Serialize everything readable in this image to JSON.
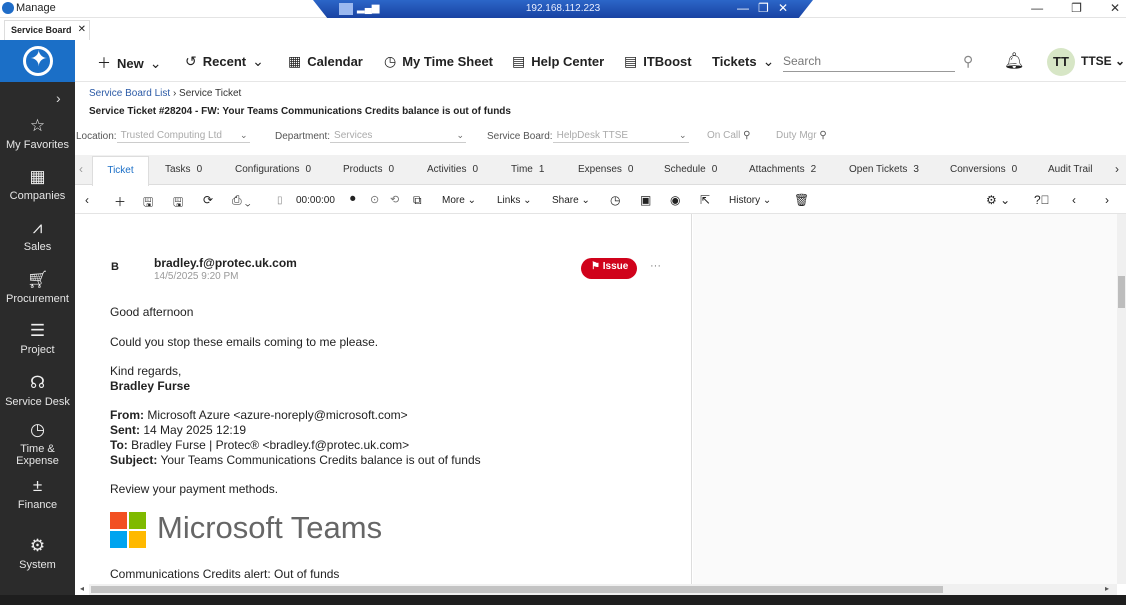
{
  "window": {
    "title": "Manage",
    "ip": "192.168.112.223"
  },
  "browser_tab": {
    "label": "Service Board"
  },
  "header": {
    "new": "New",
    "recent": "Recent",
    "calendar": "Calendar",
    "timesheet": "My Time Sheet",
    "help": "Help Center",
    "itboost": "ITBoost",
    "tickets": "Tickets",
    "search_placeholder": "Search",
    "avatar_initials": "TT",
    "user": "TTSE"
  },
  "sidebar": {
    "items": [
      {
        "label": "My Favorites",
        "icon": "star-icon"
      },
      {
        "label": "Companies",
        "icon": "building-icon"
      },
      {
        "label": "Sales",
        "icon": "chart-icon"
      },
      {
        "label": "Procurement",
        "icon": "cart-icon"
      },
      {
        "label": "Project",
        "icon": "project-icon"
      },
      {
        "label": "Service Desk",
        "icon": "headset-icon"
      },
      {
        "label": "Time &",
        "label2": "Expense",
        "icon": "clock-icon"
      },
      {
        "label": "Finance",
        "icon": "calculator-icon"
      },
      {
        "label": "System",
        "icon": "gear-icon"
      }
    ]
  },
  "breadcrumb": {
    "list": "Service Board List",
    "current": "Service Ticket"
  },
  "ticket": {
    "title": "Service Ticket #28204 - FW: Your Teams Communications Credits balance is out of funds"
  },
  "filters": {
    "location_label": "Location:",
    "location_value": "Trusted Computing Ltd",
    "department_label": "Department:",
    "department_value": "Services",
    "board_label": "Service Board:",
    "board_value": "HelpDesk TTSE",
    "on_call": "On Call",
    "duty_mgr": "Duty Mgr"
  },
  "tabs": [
    {
      "label": "Ticket",
      "count": ""
    },
    {
      "label": "Tasks",
      "count": "0"
    },
    {
      "label": "Configurations",
      "count": "0"
    },
    {
      "label": "Products",
      "count": "0"
    },
    {
      "label": "Activities",
      "count": "0"
    },
    {
      "label": "Time",
      "count": "1"
    },
    {
      "label": "Expenses",
      "count": "0"
    },
    {
      "label": "Schedule",
      "count": "0"
    },
    {
      "label": "Attachments",
      "count": "2"
    },
    {
      "label": "Open Tickets",
      "count": "3"
    },
    {
      "label": "Conversions",
      "count": "0"
    },
    {
      "label": "Audit Trail",
      "count": ""
    }
  ],
  "toolbar": {
    "timer": "00:00:00",
    "more": "More",
    "links": "Links",
    "share": "Share",
    "history": "History"
  },
  "email": {
    "avatar": "B",
    "sender": "bradley.f@protec.uk.com",
    "date": "14/5/2025 9:20 PM",
    "badge": "Issue",
    "greeting": "Good afternoon",
    "body": "Could you stop these emails coming to me please.",
    "regards": "Kind regards,",
    "signature": "Bradley Furse",
    "from_label": "From:",
    "from": "Microsoft Azure <azure-noreply@microsoft.com>",
    "sent_label": "Sent:",
    "sent": "14 May 2025 12:19",
    "to_label": "To:",
    "to": "Bradley Furse | Protec® <bradley.f@protec.uk.com>",
    "subject_label": "Subject:",
    "subject": "Your Teams Communications Credits balance is out of funds",
    "review": "Review your payment methods.",
    "brand": "Microsoft Teams",
    "alert": "Communications Credits alert: Out of funds"
  },
  "colors": {
    "accent": "#1b6fc7",
    "sidebar": "#2b2b2b",
    "issue": "#d0021b"
  }
}
